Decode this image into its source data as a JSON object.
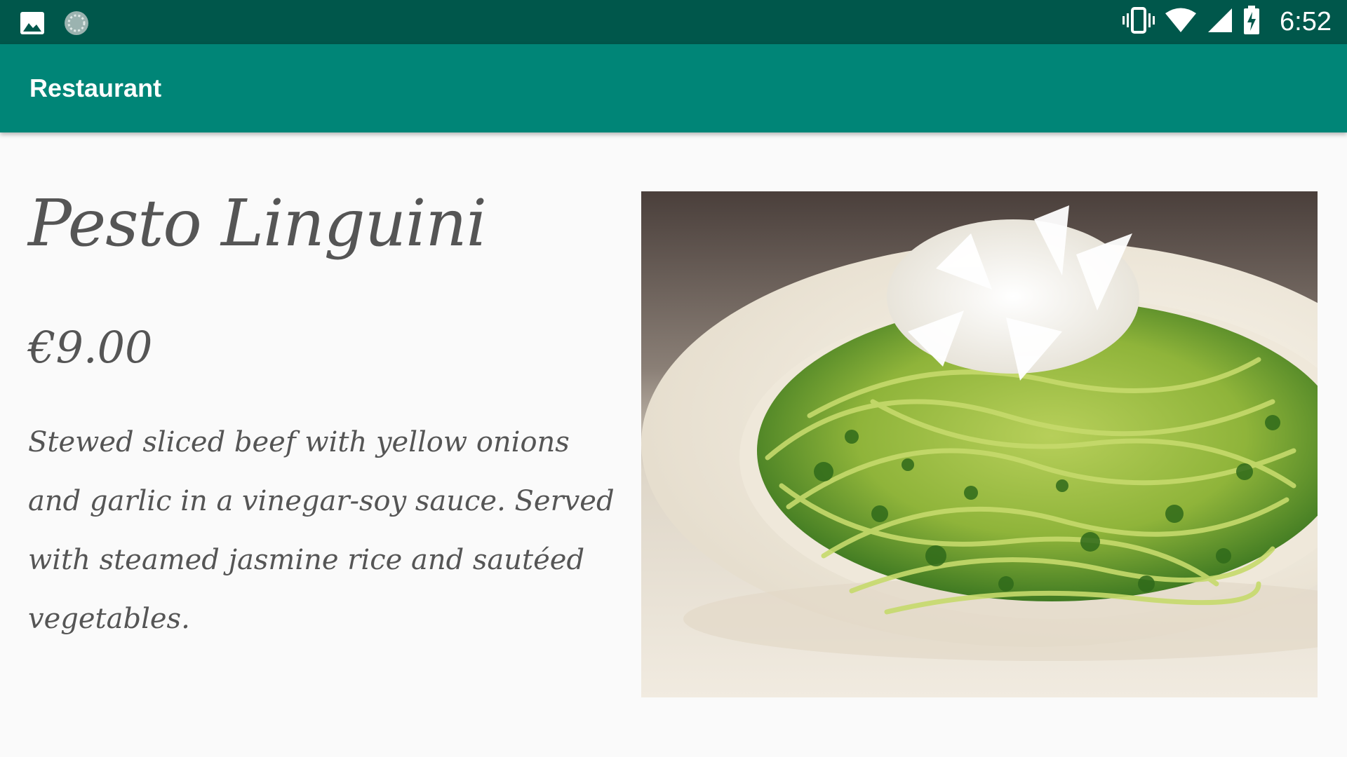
{
  "status_bar": {
    "time": "6:52",
    "left_icons": [
      "image-icon",
      "sync-icon"
    ],
    "right_icons": [
      "vibrate-icon",
      "wifi-icon",
      "signal-icon",
      "battery-charging-icon"
    ]
  },
  "app_bar": {
    "title": "Restaurant"
  },
  "dish": {
    "name": "Pesto Linguini",
    "price": "€9.00",
    "description": "Stewed sliced beef with yellow onions and garlic in a vinegar-soy sauce. Served with steamed jasmine rice and sautéed vegetables.",
    "image_icon": "pesto-linguini-photo"
  },
  "colors": {
    "status_bar": "#00574b",
    "app_bar": "#008577",
    "background": "#fafafa",
    "text": "#555555"
  }
}
